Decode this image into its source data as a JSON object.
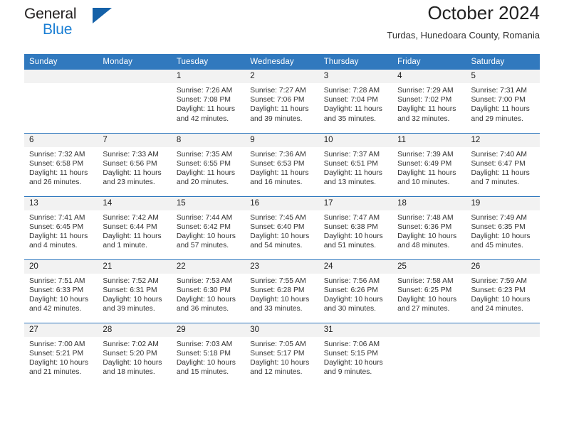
{
  "brand": {
    "line1": "General",
    "line2": "Blue",
    "triangle_icon": "brand-triangle-icon",
    "colors": {
      "dark": "#221f1f",
      "blue": "#1b7fd4",
      "triangle": "#1461a8"
    }
  },
  "header": {
    "title": "October 2024",
    "subtitle": "Turdas, Hunedoara County, Romania"
  },
  "theme": {
    "header_bg": "#3179be",
    "header_text": "#ffffff",
    "daynum_bg": "#f2f2f2",
    "row_divider": "#3179be",
    "body_text": "#333333"
  },
  "weekdays": [
    "Sunday",
    "Monday",
    "Tuesday",
    "Wednesday",
    "Thursday",
    "Friday",
    "Saturday"
  ],
  "labels": {
    "sunrise_prefix": "Sunrise:",
    "sunset_prefix": "Sunset:",
    "daylight_prefix": "Daylight:"
  },
  "weeks": [
    [
      {
        "day": "",
        "sunrise": "",
        "sunset": "",
        "daylight": "",
        "blank": true
      },
      {
        "day": "",
        "sunrise": "",
        "sunset": "",
        "daylight": "",
        "blank": true
      },
      {
        "day": "1",
        "sunrise": "Sunrise: 7:26 AM",
        "sunset": "Sunset: 7:08 PM",
        "daylight": "Daylight: 11 hours and 42 minutes."
      },
      {
        "day": "2",
        "sunrise": "Sunrise: 7:27 AM",
        "sunset": "Sunset: 7:06 PM",
        "daylight": "Daylight: 11 hours and 39 minutes."
      },
      {
        "day": "3",
        "sunrise": "Sunrise: 7:28 AM",
        "sunset": "Sunset: 7:04 PM",
        "daylight": "Daylight: 11 hours and 35 minutes."
      },
      {
        "day": "4",
        "sunrise": "Sunrise: 7:29 AM",
        "sunset": "Sunset: 7:02 PM",
        "daylight": "Daylight: 11 hours and 32 minutes."
      },
      {
        "day": "5",
        "sunrise": "Sunrise: 7:31 AM",
        "sunset": "Sunset: 7:00 PM",
        "daylight": "Daylight: 11 hours and 29 minutes."
      }
    ],
    [
      {
        "day": "6",
        "sunrise": "Sunrise: 7:32 AM",
        "sunset": "Sunset: 6:58 PM",
        "daylight": "Daylight: 11 hours and 26 minutes."
      },
      {
        "day": "7",
        "sunrise": "Sunrise: 7:33 AM",
        "sunset": "Sunset: 6:56 PM",
        "daylight": "Daylight: 11 hours and 23 minutes."
      },
      {
        "day": "8",
        "sunrise": "Sunrise: 7:35 AM",
        "sunset": "Sunset: 6:55 PM",
        "daylight": "Daylight: 11 hours and 20 minutes."
      },
      {
        "day": "9",
        "sunrise": "Sunrise: 7:36 AM",
        "sunset": "Sunset: 6:53 PM",
        "daylight": "Daylight: 11 hours and 16 minutes."
      },
      {
        "day": "10",
        "sunrise": "Sunrise: 7:37 AM",
        "sunset": "Sunset: 6:51 PM",
        "daylight": "Daylight: 11 hours and 13 minutes."
      },
      {
        "day": "11",
        "sunrise": "Sunrise: 7:39 AM",
        "sunset": "Sunset: 6:49 PM",
        "daylight": "Daylight: 11 hours and 10 minutes."
      },
      {
        "day": "12",
        "sunrise": "Sunrise: 7:40 AM",
        "sunset": "Sunset: 6:47 PM",
        "daylight": "Daylight: 11 hours and 7 minutes."
      }
    ],
    [
      {
        "day": "13",
        "sunrise": "Sunrise: 7:41 AM",
        "sunset": "Sunset: 6:45 PM",
        "daylight": "Daylight: 11 hours and 4 minutes."
      },
      {
        "day": "14",
        "sunrise": "Sunrise: 7:42 AM",
        "sunset": "Sunset: 6:44 PM",
        "daylight": "Daylight: 11 hours and 1 minute."
      },
      {
        "day": "15",
        "sunrise": "Sunrise: 7:44 AM",
        "sunset": "Sunset: 6:42 PM",
        "daylight": "Daylight: 10 hours and 57 minutes."
      },
      {
        "day": "16",
        "sunrise": "Sunrise: 7:45 AM",
        "sunset": "Sunset: 6:40 PM",
        "daylight": "Daylight: 10 hours and 54 minutes."
      },
      {
        "day": "17",
        "sunrise": "Sunrise: 7:47 AM",
        "sunset": "Sunset: 6:38 PM",
        "daylight": "Daylight: 10 hours and 51 minutes."
      },
      {
        "day": "18",
        "sunrise": "Sunrise: 7:48 AM",
        "sunset": "Sunset: 6:36 PM",
        "daylight": "Daylight: 10 hours and 48 minutes."
      },
      {
        "day": "19",
        "sunrise": "Sunrise: 7:49 AM",
        "sunset": "Sunset: 6:35 PM",
        "daylight": "Daylight: 10 hours and 45 minutes."
      }
    ],
    [
      {
        "day": "20",
        "sunrise": "Sunrise: 7:51 AM",
        "sunset": "Sunset: 6:33 PM",
        "daylight": "Daylight: 10 hours and 42 minutes."
      },
      {
        "day": "21",
        "sunrise": "Sunrise: 7:52 AM",
        "sunset": "Sunset: 6:31 PM",
        "daylight": "Daylight: 10 hours and 39 minutes."
      },
      {
        "day": "22",
        "sunrise": "Sunrise: 7:53 AM",
        "sunset": "Sunset: 6:30 PM",
        "daylight": "Daylight: 10 hours and 36 minutes."
      },
      {
        "day": "23",
        "sunrise": "Sunrise: 7:55 AM",
        "sunset": "Sunset: 6:28 PM",
        "daylight": "Daylight: 10 hours and 33 minutes."
      },
      {
        "day": "24",
        "sunrise": "Sunrise: 7:56 AM",
        "sunset": "Sunset: 6:26 PM",
        "daylight": "Daylight: 10 hours and 30 minutes."
      },
      {
        "day": "25",
        "sunrise": "Sunrise: 7:58 AM",
        "sunset": "Sunset: 6:25 PM",
        "daylight": "Daylight: 10 hours and 27 minutes."
      },
      {
        "day": "26",
        "sunrise": "Sunrise: 7:59 AM",
        "sunset": "Sunset: 6:23 PM",
        "daylight": "Daylight: 10 hours and 24 minutes."
      }
    ],
    [
      {
        "day": "27",
        "sunrise": "Sunrise: 7:00 AM",
        "sunset": "Sunset: 5:21 PM",
        "daylight": "Daylight: 10 hours and 21 minutes."
      },
      {
        "day": "28",
        "sunrise": "Sunrise: 7:02 AM",
        "sunset": "Sunset: 5:20 PM",
        "daylight": "Daylight: 10 hours and 18 minutes."
      },
      {
        "day": "29",
        "sunrise": "Sunrise: 7:03 AM",
        "sunset": "Sunset: 5:18 PM",
        "daylight": "Daylight: 10 hours and 15 minutes."
      },
      {
        "day": "30",
        "sunrise": "Sunrise: 7:05 AM",
        "sunset": "Sunset: 5:17 PM",
        "daylight": "Daylight: 10 hours and 12 minutes."
      },
      {
        "day": "31",
        "sunrise": "Sunrise: 7:06 AM",
        "sunset": "Sunset: 5:15 PM",
        "daylight": "Daylight: 10 hours and 9 minutes."
      },
      {
        "day": "",
        "sunrise": "",
        "sunset": "",
        "daylight": "",
        "blank": true
      },
      {
        "day": "",
        "sunrise": "",
        "sunset": "",
        "daylight": "",
        "blank": true
      }
    ]
  ]
}
